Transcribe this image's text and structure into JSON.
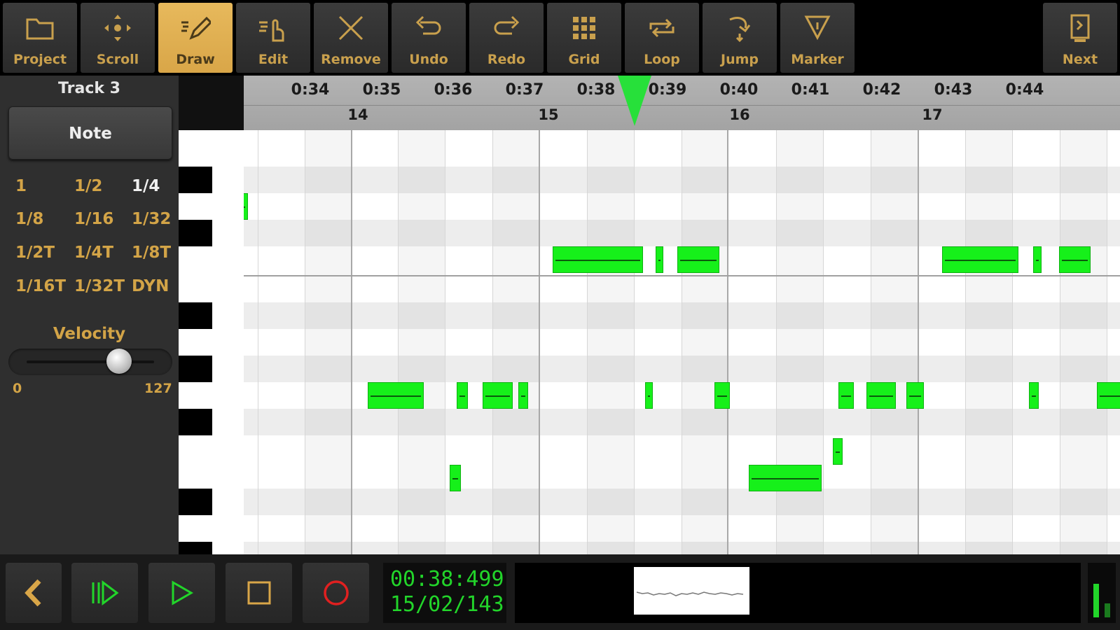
{
  "toolbar": {
    "tools": [
      {
        "label": "Project",
        "icon": "folder-icon",
        "active": false
      },
      {
        "label": "Scroll",
        "icon": "scroll-arrows-icon",
        "active": false
      },
      {
        "label": "Draw",
        "icon": "pencil-icon",
        "active": true
      },
      {
        "label": "Edit",
        "icon": "hand-icon",
        "active": false
      },
      {
        "label": "Remove",
        "icon": "x-icon",
        "active": false
      },
      {
        "label": "Undo",
        "icon": "undo-icon",
        "active": false
      },
      {
        "label": "Redo",
        "icon": "redo-icon",
        "active": false
      },
      {
        "label": "Grid",
        "icon": "grid-icon",
        "active": false
      },
      {
        "label": "Loop",
        "icon": "loop-icon",
        "active": false
      },
      {
        "label": "Jump",
        "icon": "jump-icon",
        "active": false
      },
      {
        "label": "Marker",
        "icon": "marker-icon",
        "active": false
      }
    ],
    "next_label": "Next"
  },
  "left_panel": {
    "track_title": "Track 3",
    "mode_button": "Note",
    "quantize": [
      [
        "1",
        "1/2",
        "1/4"
      ],
      [
        "1/8",
        "1/16",
        "1/32"
      ],
      [
        "1/2T",
        "1/4T",
        "1/8T"
      ],
      [
        "1/16T",
        "1/32T",
        "DYN"
      ]
    ],
    "quantize_selected": "1/4",
    "velocity": {
      "label": "Velocity",
      "min": "0",
      "max": "127",
      "value": 93
    }
  },
  "ruler": {
    "times": [
      "0:34",
      "0:35",
      "0:36",
      "0:37",
      "0:38",
      "0:39",
      "0:40",
      "0:41",
      "0:42",
      "0:43",
      "0:44"
    ],
    "bars": [
      "14",
      "15",
      "16",
      "17"
    ]
  },
  "transport": {
    "time": "00:38:499",
    "position": "15/02/143"
  },
  "colors": {
    "accent": "#d9a648",
    "note": "#16f01a",
    "lcd_text": "#22d52a",
    "playhead": "#27e03a"
  }
}
